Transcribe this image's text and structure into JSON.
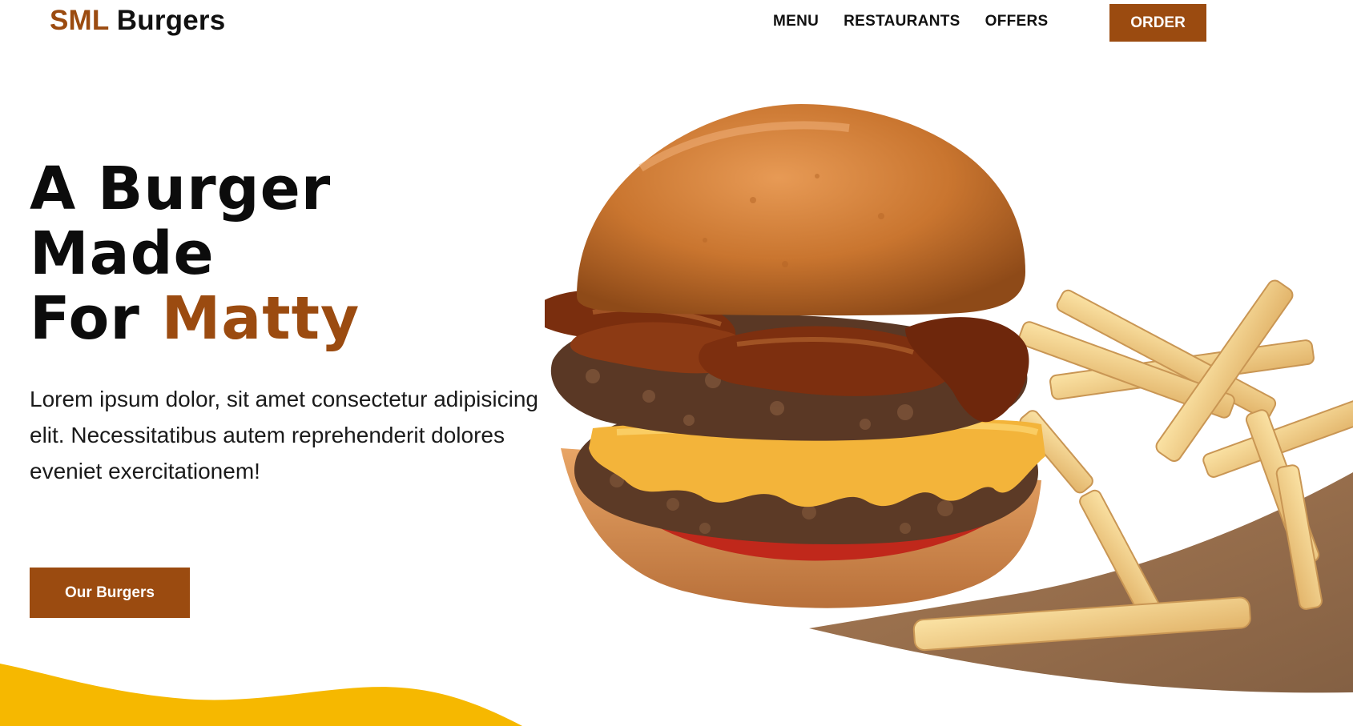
{
  "header": {
    "brand_accent": "SML",
    "brand_rest": "Burgers",
    "nav": [
      "MENU",
      "RESTAURANTS",
      "OFFERS"
    ],
    "order_label": "ORDER"
  },
  "hero": {
    "headline_line1": "A Burger",
    "headline_line2": "Made",
    "headline_line3_plain": "For",
    "headline_line3_accent": "Matty",
    "body": "Lorem ipsum dolor, sit amet consectetur adipisicing elit. Necessitatibus autem reprehenderit dolores eveniet exercitationem!",
    "cta_label": "Our Burgers",
    "image": "burger-with-fries-photo"
  },
  "colors": {
    "accent": "#9b4b10",
    "wave": "#f6b800",
    "text": "#111111",
    "background": "#ffffff"
  }
}
